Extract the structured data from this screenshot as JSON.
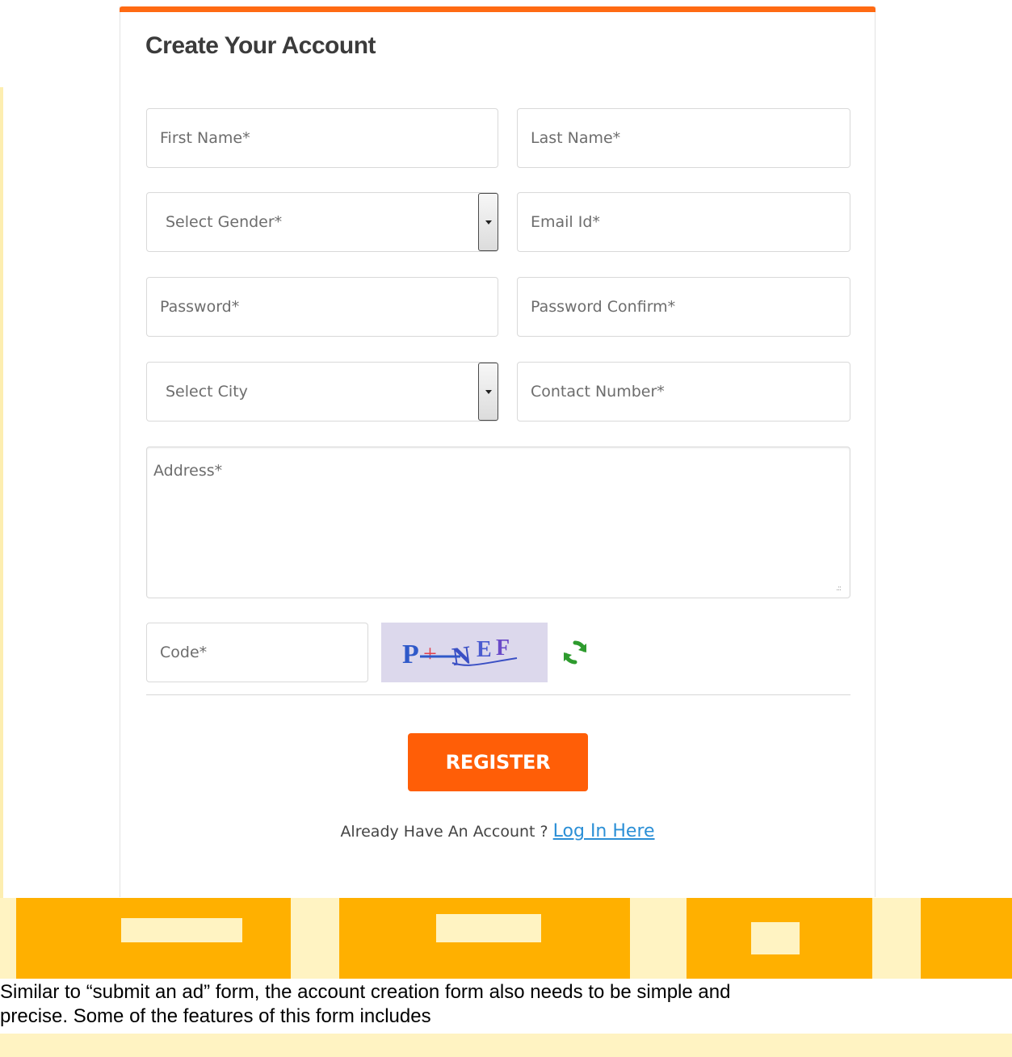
{
  "form": {
    "title": "Create Your Account",
    "first_name_placeholder": "First Name*",
    "last_name_placeholder": "Last Name*",
    "gender_label": "Select Gender*",
    "email_placeholder": "Email Id*",
    "password_placeholder": "Password*",
    "password_confirm_placeholder": "Password Confirm*",
    "city_label": "Select City",
    "contact_placeholder": "Contact Number*",
    "address_placeholder": "Address*",
    "code_placeholder": "Code*",
    "captcha_text": "P+NEF",
    "register_label": "REGISTER",
    "login_prompt": "Already Have An Account ?",
    "login_link": "Log In Here"
  },
  "colors": {
    "accent": "#ff6a13",
    "button": "#ff5e07",
    "link": "#2b8fd6",
    "refresh_icon": "#2e9b2e",
    "banner": "#ffb000"
  },
  "icons": {
    "refresh": "refresh-icon",
    "dropdown": "chevron-down-icon"
  },
  "description": {
    "line1": "Similar to “submit an ad” form, the account creation form also needs to be simple and",
    "line2": "precise. Some of the features of this form includes"
  }
}
